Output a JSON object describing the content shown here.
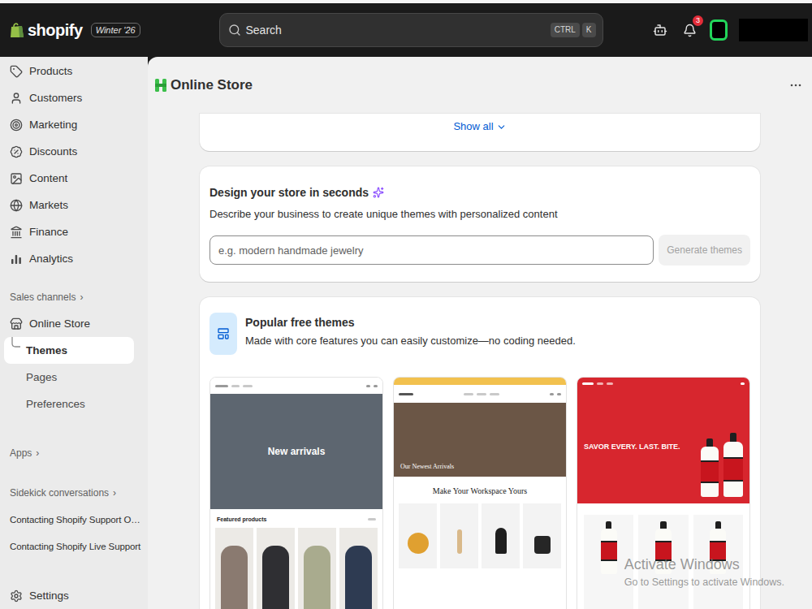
{
  "topbar": {
    "logo": "shopify",
    "edition": "Winter '26",
    "search": {
      "placeholder": "Search",
      "keys": [
        "CTRL",
        "K"
      ]
    },
    "notifications": {
      "count": "3"
    }
  },
  "sidebar": {
    "items": [
      {
        "label": "Products",
        "selected": false
      },
      {
        "label": "Customers",
        "selected": false
      },
      {
        "label": "Marketing",
        "selected": false
      },
      {
        "label": "Discounts",
        "selected": false
      },
      {
        "label": "Content",
        "selected": false
      },
      {
        "label": "Markets",
        "selected": false
      },
      {
        "label": "Finance",
        "selected": false
      },
      {
        "label": "Analytics",
        "selected": false
      }
    ],
    "sales_channels": {
      "label": "Sales channels",
      "chevron": "›",
      "items": [
        {
          "label": "Online Store",
          "expanded": true,
          "children": [
            {
              "label": "Themes",
              "selected": true
            },
            {
              "label": "Pages",
              "selected": false
            },
            {
              "label": "Preferences",
              "selected": false
            }
          ]
        }
      ]
    },
    "apps": {
      "label": "Apps",
      "chevron": "›"
    },
    "sidekick": {
      "label": "Sidekick conversations",
      "chevron": "›",
      "items": [
        "Contacting Shopify Support O…",
        "Contacting Shopify Live Support"
      ]
    },
    "settings": {
      "label": "Settings"
    }
  },
  "page": {
    "title": "Online Store",
    "show_all": "Show all",
    "design_card": {
      "title": "Design your store in seconds",
      "subtitle": "Describe your business to create unique themes with personalized content",
      "input": {
        "placeholder": "e.g. modern handmade jewelry",
        "value": ""
      },
      "button": {
        "label": "Generate themes",
        "disabled": true
      }
    },
    "themes_card": {
      "title": "Popular free themes",
      "subtitle": "Made with core features you can easily customize—no coding needed.",
      "themes": [
        {
          "kind": "apparel",
          "hero": "New arrivals",
          "section": "Featured products",
          "color": "#5d6670"
        },
        {
          "kind": "workspace",
          "hero": "Our Newest Arrivals",
          "section": "Make Your Workspace Yours",
          "color": "#f2c14e"
        },
        {
          "kind": "food",
          "hero": "SAVOR EVERY. LAST. BITE.",
          "color": "#d7262e"
        }
      ]
    }
  },
  "watermark": {
    "title": "Activate Windows",
    "subtitle": "Go to Settings to activate Windows."
  }
}
